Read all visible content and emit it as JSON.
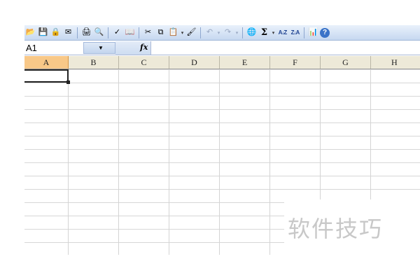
{
  "toolbar": {
    "buttons": [
      {
        "icon": "open-icon",
        "glyph": "📂"
      },
      {
        "icon": "save-icon",
        "glyph": "💾"
      },
      {
        "icon": "permission-icon",
        "glyph": "🔒"
      },
      {
        "icon": "email-icon",
        "glyph": "✉"
      },
      {
        "icon": "print-icon",
        "glyph": "🖨"
      },
      {
        "icon": "print-preview-icon",
        "glyph": "🔍"
      },
      {
        "icon": "spelling-icon",
        "glyph": "✓"
      },
      {
        "icon": "research-icon",
        "glyph": "📖"
      },
      {
        "icon": "cut-icon",
        "glyph": "✂"
      },
      {
        "icon": "copy-icon",
        "glyph": "⧉"
      },
      {
        "icon": "paste-icon",
        "glyph": "📋"
      },
      {
        "icon": "format-painter-icon",
        "glyph": "🖌"
      },
      {
        "icon": "undo-icon",
        "glyph": "↶"
      },
      {
        "icon": "redo-icon",
        "glyph": "↷"
      },
      {
        "icon": "hyperlink-icon",
        "glyph": "🌐"
      },
      {
        "icon": "autosum-icon",
        "glyph": "Σ"
      },
      {
        "icon": "sort-ascending-icon",
        "glyph": "A↓Z"
      },
      {
        "icon": "sort-descending-icon",
        "glyph": "Z↓A"
      },
      {
        "icon": "chart-wizard-icon",
        "glyph": "📊"
      },
      {
        "icon": "help-icon",
        "glyph": "?"
      }
    ],
    "dropdown_glyph": "▾"
  },
  "formula_bar": {
    "name_box": "A1",
    "name_dropdown_glyph": "▼",
    "fx_label": "fx",
    "formula_value": ""
  },
  "sheet": {
    "columns": [
      "A",
      "B",
      "C",
      "D",
      "E",
      "F",
      "G",
      "H"
    ],
    "active_column": "A",
    "active_cell": "A1",
    "row_count": 14
  },
  "watermark": {
    "text": "软件技巧"
  },
  "colors": {
    "toolbar_bg_top": "#e9f1fb",
    "toolbar_bg_bottom": "#c6d8f0",
    "header_bg": "#ede9d8",
    "active_header_bg": "#f8c888",
    "gridline": "#d7d7d7"
  }
}
